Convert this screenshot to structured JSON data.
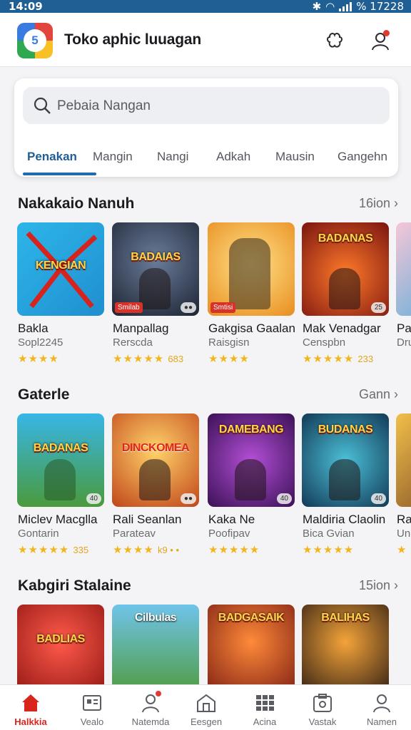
{
  "status_bar": {
    "time": "14:09",
    "right_text": "% 17228"
  },
  "header": {
    "title": "Toko aphic luuagan",
    "logo_text": "5"
  },
  "search": {
    "placeholder": "Pebaia Nangan"
  },
  "tabs": [
    "Penakan",
    "Mangin",
    "Nangi",
    "Adkah",
    "Mausin",
    "Gangehn"
  ],
  "sections": [
    {
      "title": "Nakakaio Nanuh",
      "more": "16ion",
      "cards": [
        {
          "name": "Bakla",
          "sub": "Sopl2245",
          "stars": "★★★★",
          "count": "",
          "banner": "KENGIAN",
          "tag": "",
          "pill": ""
        },
        {
          "name": "Manpallag",
          "sub": "Rerscda",
          "stars": "★★★★★",
          "count": "683",
          "banner": "BADAIAS",
          "tag": "Smilab",
          "pill": "●●"
        },
        {
          "name": "Gakgisa Gaalan",
          "sub": "Raisgisn",
          "stars": "★★★★",
          "count": "",
          "banner": "",
          "tag": "Smtisi",
          "pill": ""
        },
        {
          "name": "Mak Venadgar",
          "sub": "Censpbn",
          "stars": "★★★★★",
          "count": "233",
          "banner": "BADANAS",
          "tag": "",
          "pill": "25"
        },
        {
          "name": "Pa",
          "sub": "Dru",
          "stars": "",
          "count": "",
          "banner": "",
          "tag": "",
          "pill": ""
        }
      ]
    },
    {
      "title": "Gaterle",
      "more": "Gann",
      "cards": [
        {
          "name": "Miclev Macglla",
          "sub": "Gontarin",
          "stars": "★★★★★",
          "count": "335",
          "banner": "BADANAS",
          "tag": "",
          "pill": "40"
        },
        {
          "name": "Rali Seanlan",
          "sub": "Parateav",
          "stars": "★★★★",
          "count": "k9 • •",
          "banner": "DINCKOMEA",
          "tag": "",
          "pill": "●●"
        },
        {
          "name": "Kaka Ne",
          "sub": "Poofipav",
          "stars": "★★★★★",
          "count": "",
          "banner": "DAMEBANG",
          "tag": "",
          "pill": "40"
        },
        {
          "name": "Maldiria Claolin",
          "sub": "Bica Gvian",
          "stars": "★★★★★",
          "count": "",
          "banner": "BUDANAS",
          "tag": "",
          "pill": "40"
        },
        {
          "name": "Ra",
          "sub": "Un",
          "stars": "★",
          "count": "",
          "banner": "",
          "tag": "",
          "pill": ""
        }
      ]
    },
    {
      "title": "Kabgiri Stalaine",
      "more": "15ion",
      "cards": [
        {
          "name": "",
          "sub": "",
          "stars": "",
          "count": "",
          "banner": "BADLIAS",
          "tag": "",
          "pill": ""
        },
        {
          "name": "",
          "sub": "",
          "stars": "",
          "count": "",
          "banner": "Cilbulas",
          "tag": "",
          "pill": ""
        },
        {
          "name": "",
          "sub": "",
          "stars": "",
          "count": "",
          "banner": "BADGASAIK",
          "tag": "",
          "pill": ""
        },
        {
          "name": "",
          "sub": "",
          "stars": "",
          "count": "",
          "banner": "BALIHAS",
          "tag": "",
          "pill": ""
        },
        {
          "name": "",
          "sub": "",
          "stars": "",
          "count": "",
          "banner": "",
          "tag": "",
          "pill": ""
        }
      ]
    }
  ],
  "bottom_nav": [
    "Halkkia",
    "Vealo",
    "Natemda",
    "Eesgen",
    "Acina",
    "Vastak",
    "Namen"
  ],
  "colors": {
    "accent": "#1f5f93",
    "active_nav": "#d8261d",
    "stars": "#f2b51c"
  },
  "icons": [
    "shuffle-icon",
    "profile-icon",
    "search-icon",
    "home-icon",
    "video-icon",
    "person-icon",
    "store-icon",
    "grid-icon",
    "camera-icon",
    "account-icon"
  ]
}
